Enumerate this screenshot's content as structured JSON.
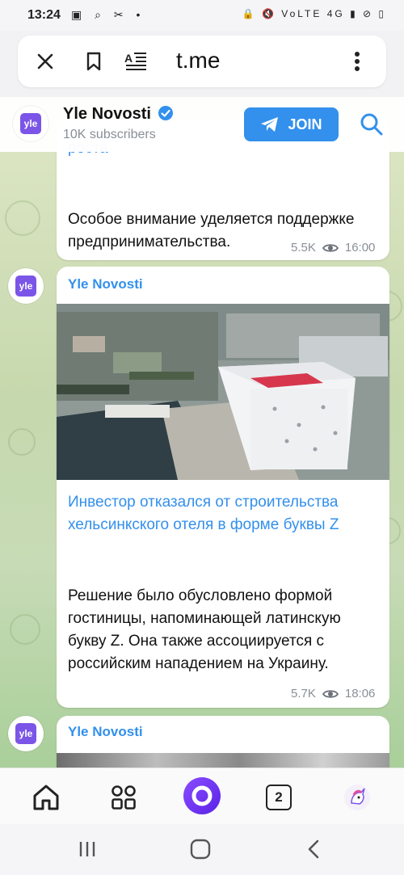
{
  "status_bar": {
    "time": "13:24",
    "left_icons": "▣ ⌕ ✂ •",
    "right_icons": "🔒 🔇 VoLTE 4G ▮ ⊘ ▯"
  },
  "browser": {
    "url": "t.me",
    "icons": [
      "close-icon",
      "bookmark-icon",
      "reader-mode-icon",
      "more-vert-icon"
    ]
  },
  "channel": {
    "name": "Yle Novosti",
    "subscribers": "10K subscribers",
    "join_label": "JOIN",
    "avatar_text": "yle"
  },
  "posts": [
    {
      "partial_top": "роста",
      "text": "Особое внимание уделяется поддержке предпринимательства.",
      "views": "5.5K",
      "time": "16:00"
    },
    {
      "sender": "Yle Novosti",
      "title": "Инвестор отказался от строительства хельсинкского отеля в форме буквы Z",
      "text": "Решение было обусловлено формой гостиницы, напоминающей латинскую букву Z. Она также ассоциируется с российским нападением на Украину.",
      "views": "5.7K",
      "time": "18:06"
    },
    {
      "sender": "Yle Novosti"
    }
  ],
  "bottom_nav": {
    "tabs_count": "2",
    "icons": [
      "home-icon",
      "apps-grid-icon",
      "alice-assistant-icon",
      "tabs-icon",
      "profile-unicorn-icon"
    ]
  },
  "colors": {
    "accent": "#3390ec",
    "yle_purple": "#7b55e7"
  }
}
